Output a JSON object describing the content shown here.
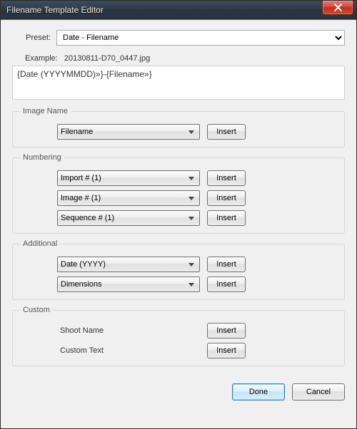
{
  "window": {
    "title": "Filename Template Editor"
  },
  "preset": {
    "label": "Preset:",
    "value": "Date - Filename"
  },
  "example": {
    "label": "Example:",
    "value": "20130811-D70_0447.jpg"
  },
  "template": {
    "value": "{Date (YYYYMMDD)»}-{Filename»}"
  },
  "sections": {
    "imageName": {
      "legend": "Image Name",
      "field1": {
        "value": "Filename",
        "insert": "Insert"
      }
    },
    "numbering": {
      "legend": "Numbering",
      "field1": {
        "value": "Import # (1)",
        "insert": "Insert"
      },
      "field2": {
        "value": "Image # (1)",
        "insert": "Insert"
      },
      "field3": {
        "value": "Sequence # (1)",
        "insert": "Insert"
      }
    },
    "additional": {
      "legend": "Additional",
      "field1": {
        "value": "Date (YYYY)",
        "insert": "Insert"
      },
      "field2": {
        "value": "Dimensions",
        "insert": "Insert"
      }
    },
    "custom": {
      "legend": "Custom",
      "field1": {
        "label": "Shoot Name",
        "insert": "Insert"
      },
      "field2": {
        "label": "Custom Text",
        "insert": "Insert"
      }
    }
  },
  "footer": {
    "done": "Done",
    "cancel": "Cancel"
  }
}
